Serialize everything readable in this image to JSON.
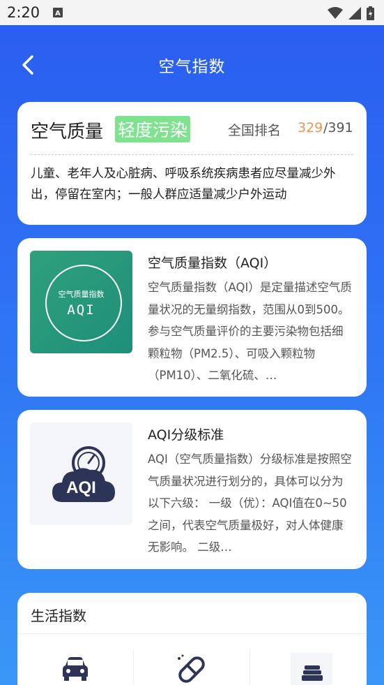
{
  "status": {
    "time": "2:20"
  },
  "header": {
    "title": "空气指数"
  },
  "air_quality": {
    "label": "空气质量",
    "level": "轻度污染",
    "rank_label": "全国排名",
    "rank": "329",
    "rank_total": "/391",
    "advice": "儿童、老年人及心脏病、呼吸系统疾病患者应尽量减少外出，停留在室内；一般人群应适量减少户外运动",
    "level_color": "#7ee28f",
    "rank_color": "#f0954e"
  },
  "articles": [
    {
      "title": "空气质量指数（AQI）",
      "body": "空气质量指数（AQI）是定量描述空气质量状况的无量纲指数，范围从0到500。参与空气质量评价的主要污染物包括细颗粒物（PM2.5）、可吸入颗粒物（PM10）、二氧化硫、…",
      "thumb_line1": "空气质量指数",
      "thumb_line2": "AQI"
    },
    {
      "title": "AQI分级标准",
      "body": "AQI（空气质量指数）分级标准是按照空气质量状况进行划分的，具体可以分为以下六级： 一级（优）：AQI值在0~50之间，代表空气质量极好，对人体健康无影响。 二级…",
      "thumb_text": "AQI"
    }
  ],
  "life": {
    "title": "生活指数",
    "items": [
      {
        "icon": "car-icon"
      },
      {
        "icon": "pill-icon"
      },
      {
        "icon": "clothes-icon"
      }
    ]
  }
}
